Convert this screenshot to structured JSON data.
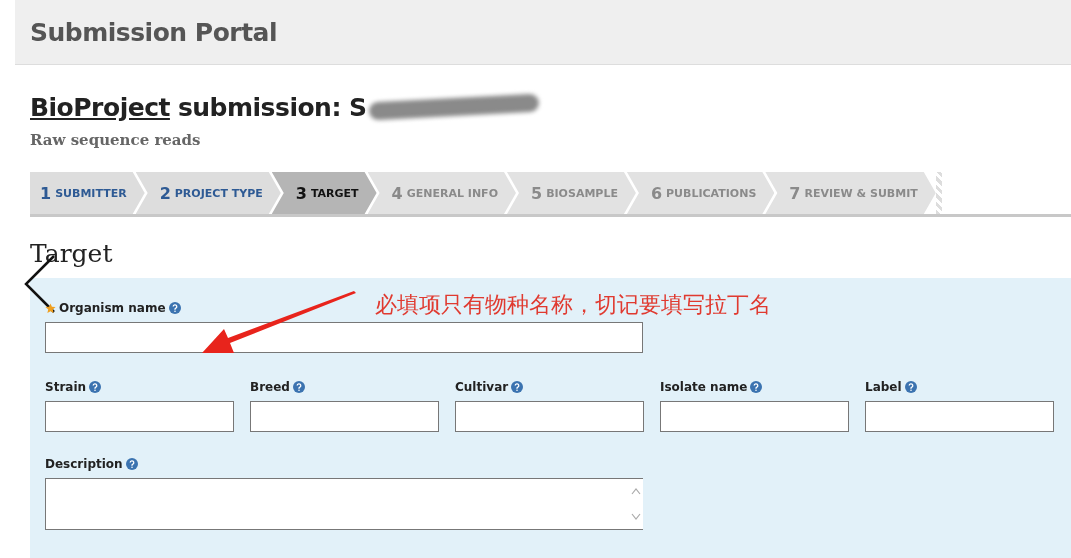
{
  "header": {
    "title": "Submission Portal"
  },
  "heading": {
    "link": "BioProject",
    "text": "submission: S"
  },
  "subtitle": "Raw sequence reads",
  "steps": [
    {
      "number": "1",
      "label": "SUBMITTER",
      "selected": false,
      "disabled": false
    },
    {
      "number": "2",
      "label": "PROJECT TYPE",
      "selected": false,
      "disabled": false
    },
    {
      "number": "3",
      "label": "TARGET",
      "selected": true,
      "disabled": false
    },
    {
      "number": "4",
      "label": "GENERAL INFO",
      "selected": false,
      "disabled": true
    },
    {
      "number": "5",
      "label": "BIOSAMPLE",
      "selected": false,
      "disabled": true
    },
    {
      "number": "6",
      "label": "PUBLICATIONS",
      "selected": false,
      "disabled": true
    },
    {
      "number": "7",
      "label": "REVIEW & SUBMIT",
      "selected": false,
      "disabled": true
    }
  ],
  "section_title": "Target",
  "annotation": "必填项只有物种名称，切记要填写拉丁名",
  "organism": {
    "label": "Organism name",
    "required": true
  },
  "fields": [
    {
      "label": "Strain"
    },
    {
      "label": "Breed"
    },
    {
      "label": "Cultivar"
    },
    {
      "label": "Isolate name"
    },
    {
      "label": "Label"
    }
  ],
  "description": {
    "label": "Description"
  }
}
